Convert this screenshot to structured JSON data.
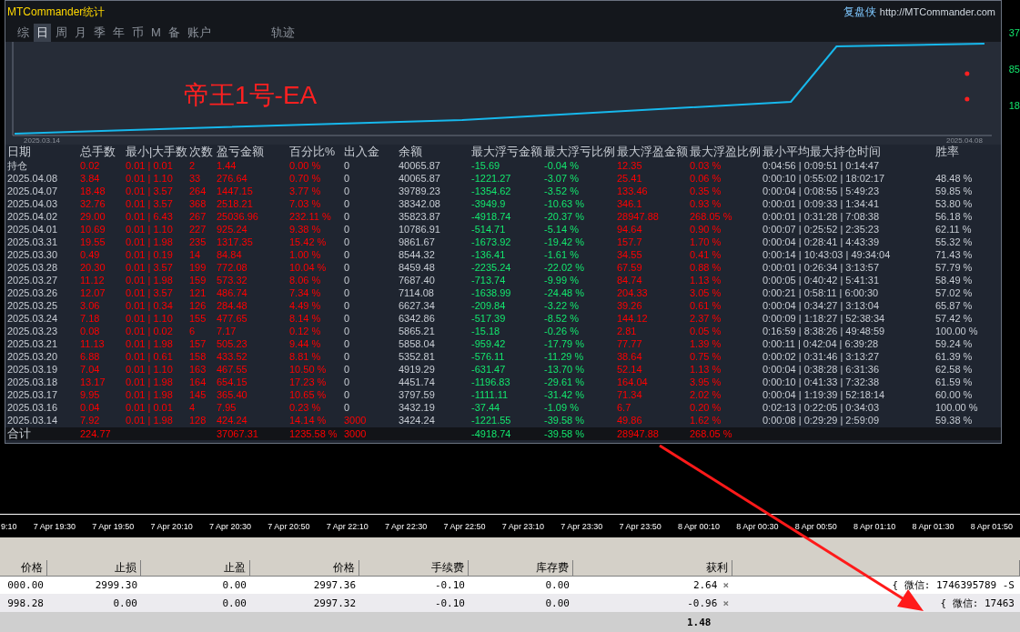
{
  "window": {
    "title": "MTCommander统计",
    "brand": "复盘侠",
    "url": "http://MTCommander.com"
  },
  "tabs": [
    {
      "label": "综",
      "selected": false
    },
    {
      "label": "日",
      "selected": true
    },
    {
      "label": "周",
      "selected": false
    },
    {
      "label": "月",
      "selected": false
    },
    {
      "label": "季",
      "selected": false
    },
    {
      "label": "年",
      "selected": false
    },
    {
      "label": "币",
      "selected": false
    },
    {
      "label": "M",
      "selected": false
    },
    {
      "label": "备",
      "selected": false
    },
    {
      "label": "账户",
      "selected": false
    },
    {
      "label": "轨迹",
      "selected": false
    }
  ],
  "chart": {
    "title": "帝王1号-EA",
    "start_date": "2025.03.14",
    "end_date": "2025.04.08"
  },
  "right_axis": [
    "37",
    "85",
    "18"
  ],
  "stats": {
    "columns": [
      "日期",
      "总手数",
      "最小|大手数",
      "次数",
      "盈亏金额",
      "百分比%",
      "出入金",
      "余额",
      "最大浮亏金额",
      "最大浮亏比例",
      "最大浮盈金额",
      "最大浮盈比例",
      "最小平均最大持仓时间",
      "胜率"
    ],
    "rows": [
      {
        "deposit": false,
        "cells": [
          "持仓",
          "0.02",
          "0.01 | 0.01",
          "2",
          "1.44",
          "0.00 %",
          "0",
          "40065.87",
          "-15.69",
          "-0.04 %",
          "12.35",
          "0.03 %",
          "0:04:56 | 0:09:51 | 0:14:47"
        ]
      },
      {
        "deposit": false,
        "cells": [
          "2025.04.08",
          "3.84",
          "0.01 | 1.10",
          "33",
          "276.64",
          "0.70 %",
          "0",
          "40065.87",
          "-1221.27",
          "-3.07 %",
          "25.41",
          "0.06 %",
          "0:00:10 | 0:55:02 | 18:02:17",
          "48.48 %"
        ]
      },
      {
        "deposit": false,
        "cells": [
          "2025.04.07",
          "18.48",
          "0.01 | 3.57",
          "264",
          "1447.15",
          "3.77 %",
          "0",
          "39789.23",
          "-1354.62",
          "-3.52 %",
          "133.46",
          "0.35 %",
          "0:00:04 | 0:08:55 | 5:49:23",
          "59.85 %"
        ]
      },
      {
        "deposit": false,
        "cells": [
          "2025.04.03",
          "32.76",
          "0.01 | 3.57",
          "368",
          "2518.21",
          "7.03 %",
          "0",
          "38342.08",
          "-3949.9",
          "-10.63 %",
          "346.1",
          "0.93 %",
          "0:00:01 | 0:09:33 | 1:34:41",
          "53.80 %"
        ]
      },
      {
        "deposit": false,
        "cells": [
          "2025.04.02",
          "29.00",
          "0.01 | 6.43",
          "267",
          "25036.96",
          "232.11 %",
          "0",
          "35823.87",
          "-4918.74",
          "-20.37 %",
          "28947.88",
          "268.05 %",
          "0:00:01 | 0:31:28 | 7:08:38",
          "56.18 %"
        ]
      },
      {
        "deposit": false,
        "cells": [
          "2025.04.01",
          "10.69",
          "0.01 | 1.10",
          "227",
          "925.24",
          "9.38 %",
          "0",
          "10786.91",
          "-514.71",
          "-5.14 %",
          "94.64",
          "0.90 %",
          "0:00:07 | 0:25:52 | 2:35:23",
          "62.11 %"
        ]
      },
      {
        "deposit": false,
        "cells": [
          "2025.03.31",
          "19.55",
          "0.01 | 1.98",
          "235",
          "1317.35",
          "15.42 %",
          "0",
          "9861.67",
          "-1673.92",
          "-19.42 %",
          "157.7",
          "1.70 %",
          "0:00:04 | 0:28:41 | 4:43:39",
          "55.32 %"
        ]
      },
      {
        "deposit": false,
        "cells": [
          "2025.03.30",
          "0.49",
          "0.01 | 0.19",
          "14",
          "84.84",
          "1.00 %",
          "0",
          "8544.32",
          "-136.41",
          "-1.61 %",
          "34.55",
          "0.41 %",
          "0:00:14 | 10:43:03 | 49:34:04",
          "71.43 %"
        ]
      },
      {
        "deposit": false,
        "cells": [
          "2025.03.28",
          "20.30",
          "0.01 | 3.57",
          "199",
          "772.08",
          "10.04 %",
          "0",
          "8459.48",
          "-2235.24",
          "-22.02 %",
          "67.59",
          "0.88 %",
          "0:00:01 | 0:26:34 | 3:13:57",
          "57.79 %"
        ]
      },
      {
        "deposit": false,
        "cells": [
          "2025.03.27",
          "11.12",
          "0.01 | 1.98",
          "159",
          "573.32",
          "8.06 %",
          "0",
          "7687.40",
          "-713.74",
          "-9.99 %",
          "84.74",
          "1.13 %",
          "0:00:05 | 0:40:42 | 5:41:31",
          "58.49 %"
        ]
      },
      {
        "deposit": false,
        "cells": [
          "2025.03.26",
          "12.07",
          "0.01 | 3.57",
          "121",
          "486.74",
          "7.34 %",
          "0",
          "7114.08",
          "-1638.99",
          "-24.48 %",
          "204.33",
          "3.05 %",
          "0:00:21 | 0:58:11 | 6:00:30",
          "57.02 %"
        ]
      },
      {
        "deposit": false,
        "cells": [
          "2025.03.25",
          "3.06",
          "0.01 | 0.34",
          "126",
          "284.48",
          "4.49 %",
          "0",
          "6627.34",
          "-209.84",
          "-3.22 %",
          "39.26",
          "0.61 %",
          "0:00:04 | 0:34:27 | 3:13:04",
          "65.87 %"
        ]
      },
      {
        "deposit": false,
        "cells": [
          "2025.03.24",
          "7.18",
          "0.01 | 1.10",
          "155",
          "477.65",
          "8.14 %",
          "0",
          "6342.86",
          "-517.39",
          "-8.52 %",
          "144.12",
          "2.37 %",
          "0:00:09 | 1:18:27 | 52:38:34",
          "57.42 %"
        ]
      },
      {
        "deposit": false,
        "cells": [
          "2025.03.23",
          "0.08",
          "0.01 | 0.02",
          "6",
          "7.17",
          "0.12 %",
          "0",
          "5865.21",
          "-15.18",
          "-0.26 %",
          "2.81",
          "0.05 %",
          "0:16:59 | 8:38:26 | 49:48:59",
          "100.00 %"
        ]
      },
      {
        "deposit": false,
        "cells": [
          "2025.03.21",
          "11.13",
          "0.01 | 1.98",
          "157",
          "505.23",
          "9.44 %",
          "0",
          "5858.04",
          "-959.42",
          "-17.79 %",
          "77.77",
          "1.39 %",
          "0:00:11 | 0:42:04 | 6:39:28",
          "59.24 %"
        ]
      },
      {
        "deposit": false,
        "cells": [
          "2025.03.20",
          "6.88",
          "0.01 | 0.61",
          "158",
          "433.52",
          "8.81 %",
          "0",
          "5352.81",
          "-576.11",
          "-11.29 %",
          "38.64",
          "0.75 %",
          "0:00:02 | 0:31:46 | 3:13:27",
          "61.39 %"
        ]
      },
      {
        "deposit": false,
        "cells": [
          "2025.03.19",
          "7.04",
          "0.01 | 1.10",
          "163",
          "467.55",
          "10.50 %",
          "0",
          "4919.29",
          "-631.47",
          "-13.70 %",
          "52.14",
          "1.13 %",
          "0:00:04 | 0:38:28 | 6:31:36",
          "62.58 %"
        ]
      },
      {
        "deposit": false,
        "cells": [
          "2025.03.18",
          "13.17",
          "0.01 | 1.98",
          "164",
          "654.15",
          "17.23 %",
          "0",
          "4451.74",
          "-1196.83",
          "-29.61 %",
          "164.04",
          "3.95 %",
          "0:00:10 | 0:41:33 | 7:32:38",
          "61.59 %"
        ]
      },
      {
        "deposit": false,
        "cells": [
          "2025.03.17",
          "9.95",
          "0.01 | 1.98",
          "145",
          "365.40",
          "10.65 %",
          "0",
          "3797.59",
          "-1111.11",
          "-31.42 %",
          "71.34",
          "2.02 %",
          "0:00:04 | 1:19:39 | 52:18:14",
          "60.00 %"
        ]
      },
      {
        "deposit": false,
        "cells": [
          "2025.03.16",
          "0.04",
          "0.01 | 0.01",
          "4",
          "7.95",
          "0.23 %",
          "0",
          "3432.19",
          "-37.44",
          "-1.09 %",
          "6.7",
          "0.20 %",
          "0:02:13 | 0:22:05 | 0:34:03",
          "100.00 %"
        ]
      },
      {
        "deposit": true,
        "cells": [
          "2025.03.14",
          "7.92",
          "0.01 | 1.98",
          "128",
          "424.24",
          "14.14 %",
          "3000",
          "3424.24",
          "-1221.55",
          "-39.58 %",
          "49.86",
          "1.62 %",
          "0:00:08 | 0:29:29 | 2:59:09",
          "59.38 %"
        ]
      }
    ],
    "total": {
      "label": "合计",
      "lots": "224.77",
      "pnl": "37067.31",
      "pct": "1235.58 %",
      "inout": "3000",
      "max_float_loss": "-4918.74",
      "max_float_loss_pct": "-39.58 %",
      "max_float_profit": "28947.88",
      "max_float_profit_pct": "268.05 %"
    }
  },
  "time_axis": [
    "9:10",
    "7 Apr 19:30",
    "7 Apr 19:50",
    "7 Apr 20:10",
    "7 Apr 20:30",
    "7 Apr 20:50",
    "7 Apr 22:10",
    "7 Apr 22:30",
    "7 Apr 22:50",
    "7 Apr 23:10",
    "7 Apr 23:30",
    "7 Apr 23:50",
    "8 Apr 00:10",
    "8 Apr 00:30",
    "8 Apr 00:50",
    "8 Apr 01:10",
    "8 Apr 01:30",
    "8 Apr 01:50"
  ],
  "orders": {
    "columns": [
      "价格",
      "止损",
      "止盈",
      "价格",
      "手续费",
      "库存费",
      "获利"
    ],
    "rows": [
      {
        "cells": [
          "000.00",
          "2999.30",
          "0.00",
          "2997.36",
          "-0.10",
          "0.00",
          "2.64"
        ],
        "close": "×",
        "comment": "{ 微信: 1746395789 -S"
      },
      {
        "cells": [
          "998.28",
          "0.00",
          "0.00",
          "2997.32",
          "-0.10",
          "0.00",
          "-0.96"
        ],
        "close": "×",
        "comment": "{ 微信: 17463"
      }
    ],
    "total": "1.48"
  }
}
